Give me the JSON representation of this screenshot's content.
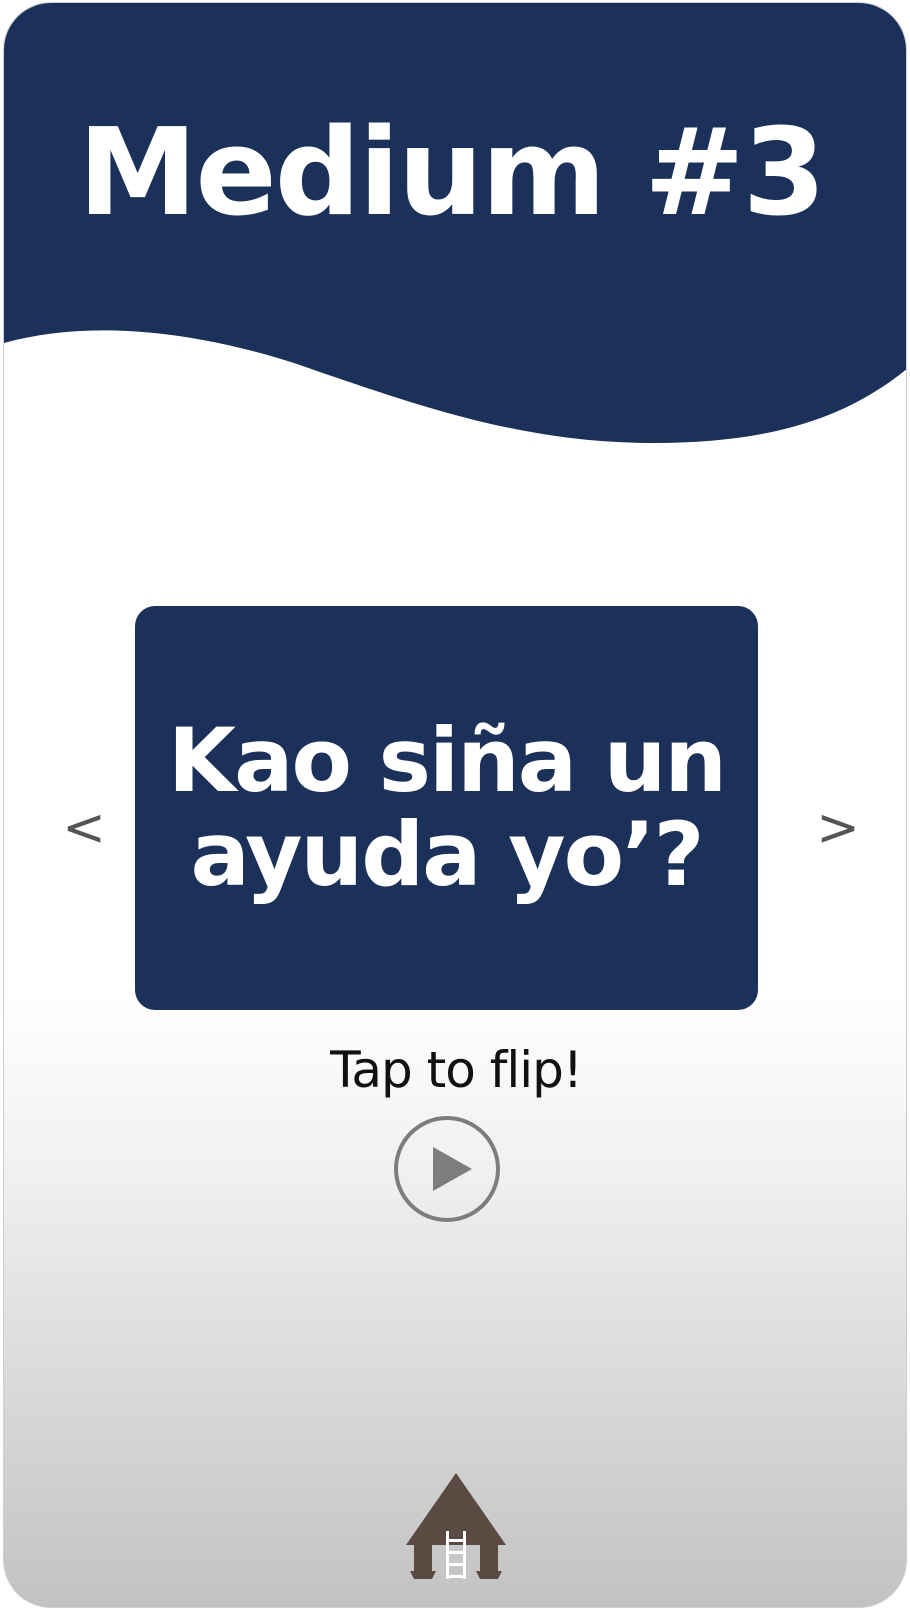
{
  "header": {
    "title": "Medium #3",
    "background_color": "#1b315a"
  },
  "card": {
    "text": "Kao siña un ayuda yo’?",
    "background_color": "#1b315a",
    "text_color": "#ffffff"
  },
  "navigation": {
    "prev_label": "<",
    "next_label": ">"
  },
  "hint": {
    "text": "Tap to flip!"
  },
  "controls": {
    "play_icon": "play-icon",
    "home_icon": "hut-home-icon"
  }
}
